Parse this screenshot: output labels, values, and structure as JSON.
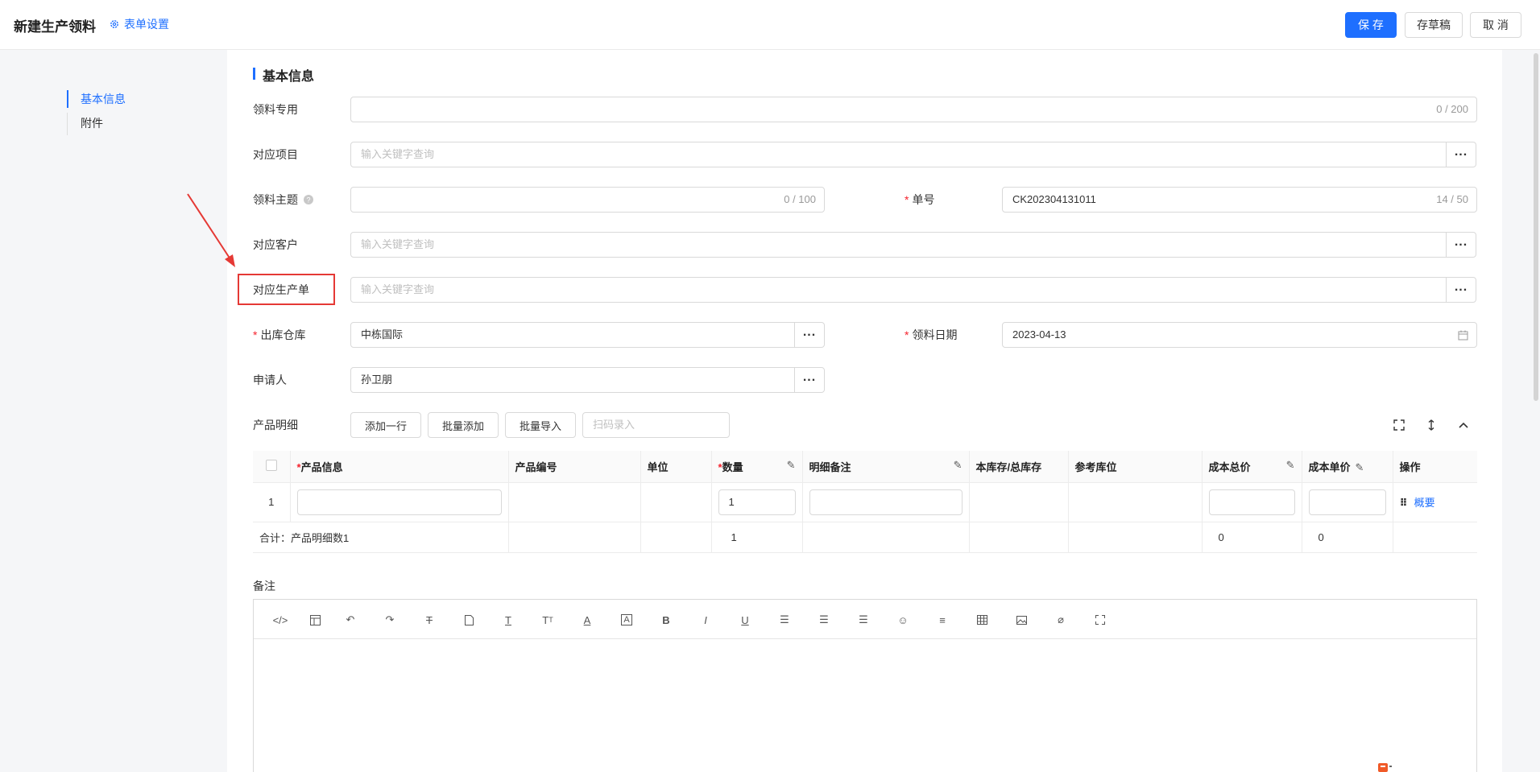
{
  "header": {
    "title": "新建生产领料",
    "form_settings": "表单设置",
    "save": "保 存",
    "draft": "存草稿",
    "cancel": "取 消"
  },
  "nav": {
    "items": [
      "基本信息",
      "附件"
    ]
  },
  "section": {
    "title": "基本信息"
  },
  "form": {
    "material_use": {
      "label": "领料专用",
      "value": "",
      "counter": "0 / 200"
    },
    "project": {
      "label": "对应项目",
      "placeholder": "输入关键字查询"
    },
    "subject": {
      "label": "领料主题",
      "value": "",
      "counter": "0 / 100"
    },
    "number": {
      "label": "单号",
      "required": "*",
      "value": "CK202304131011",
      "counter": "14 / 50"
    },
    "customer": {
      "label": "对应客户",
      "placeholder": "输入关键字查询"
    },
    "production_order": {
      "label": "对应生产单",
      "placeholder": "输入关键字查询"
    },
    "warehouse": {
      "label": "出库仓库",
      "required": "*",
      "value": "中栋国际"
    },
    "date": {
      "label": "领料日期",
      "required": "*",
      "value": "2023-04-13"
    },
    "applicant": {
      "label": "申请人",
      "value": "孙卫朋"
    }
  },
  "detail": {
    "label": "产品明细",
    "add_row": "添加一行",
    "batch_add": "批量添加",
    "batch_import": "批量导入",
    "scan_placeholder": "扫码录入",
    "columns": [
      "产品信息",
      "产品编号",
      "单位",
      "数量",
      "明细备注",
      "本库存/总库存",
      "参考库位",
      "成本总价",
      "成本单价",
      "操作"
    ],
    "required_mark": "*",
    "row": {
      "index": "1",
      "quantity": "1",
      "action": "概要"
    },
    "summary": {
      "label": "合计：产品明细数1",
      "quantity": "1",
      "total_cost": "0",
      "unit_cost": "0"
    }
  },
  "remark": {
    "label": "备注"
  },
  "colors": {
    "primary": "#1e6fff",
    "highlight_box": "#e53935"
  }
}
